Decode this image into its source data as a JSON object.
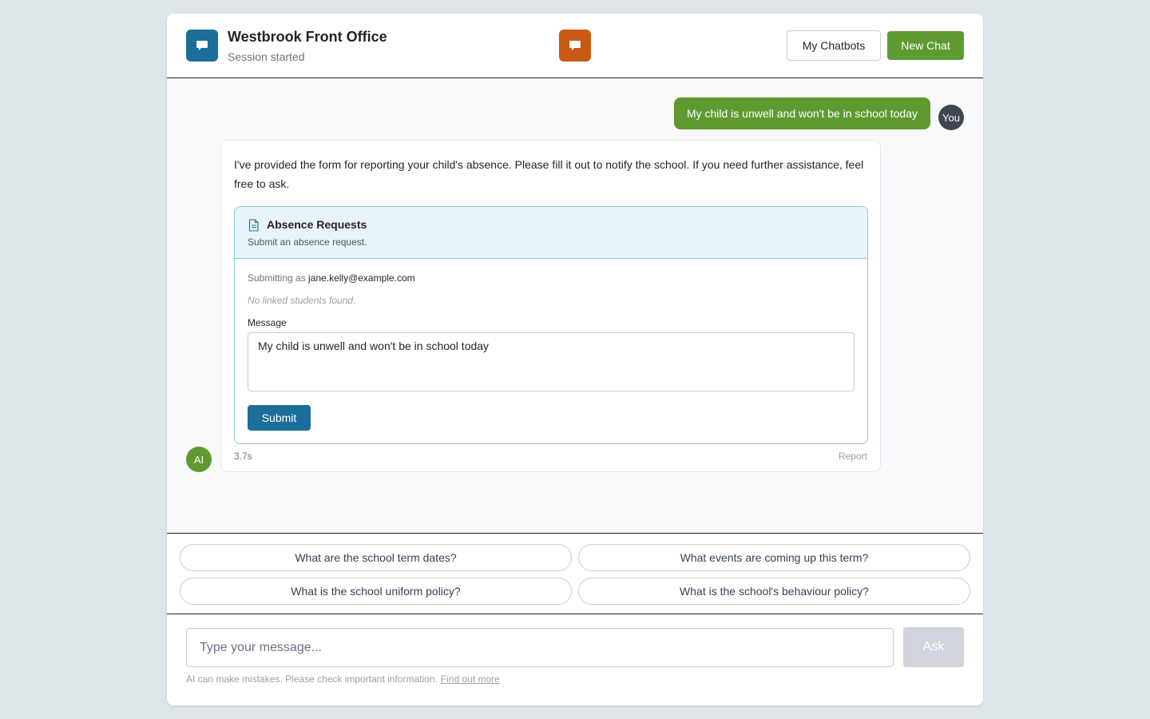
{
  "header": {
    "title": "Westbrook Front Office",
    "subtitle": "Session started",
    "brand_icon": "chat-bubble-icon",
    "center_icon": "chat-bubble-icon",
    "my_chatbots_label": "My Chatbots",
    "new_chat_label": "New Chat",
    "brand_color": "#1a6e99",
    "accent_color": "#5f9a31",
    "center_icon_color": "#c95a14"
  },
  "conversation": {
    "user_message": "My child is unwell and won't be in school today",
    "user_avatar": "You",
    "ai_avatar": "AI",
    "ai_message": "I've provided the form for reporting your child's absence. Please fill it out to notify the school. If you need further assistance, feel free to ask.",
    "response_time": "3.7s",
    "report_label": "Report"
  },
  "form": {
    "icon": "document-icon",
    "title": "Absence Requests",
    "description": "Submit an absence request.",
    "submitting_as_label": "Submitting as",
    "email": "jane.kelly@example.com",
    "no_students": "No linked students found.",
    "message_label": "Message",
    "message_value": "My child is unwell and won't be in school today",
    "submit_label": "Submit"
  },
  "suggestions": [
    "What are the school term dates?",
    "What events are coming up this term?",
    "What is the school uniform policy?",
    "What is the school's behaviour policy?"
  ],
  "composer": {
    "placeholder": "Type your message...",
    "ask_label": "Ask",
    "disclaimer": "AI can make mistakes. Please check important information.",
    "find_out_more": "Find out more"
  }
}
